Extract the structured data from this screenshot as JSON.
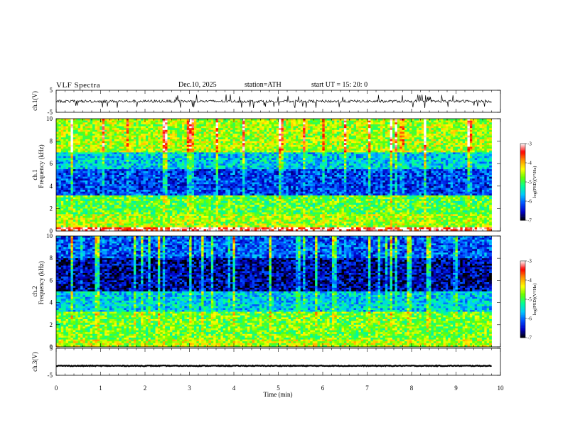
{
  "header": {
    "title": "VLF  Spectra",
    "date": "Dec.10, 2025",
    "station": "station=ATH",
    "start_ut": "start  UT  =    15: 20: 0"
  },
  "chart_data": [
    {
      "type": "line",
      "panel": "ch1-waveform",
      "ylabel": "ch.1(V)",
      "ylim": [
        -5,
        5
      ],
      "y_ticks": [
        "5",
        "-5"
      ],
      "x_range": [
        0,
        9.8
      ],
      "description_values": {
        "baseline": 0,
        "noise_amplitude": 0.6,
        "spike_amplitude": 2.5
      }
    },
    {
      "type": "heatmap",
      "panel": "ch1-spectrogram",
      "ylabel": "ch.1\nFrequency  (kHz)",
      "ylim": [
        0,
        10
      ],
      "y_ticks": [
        "0",
        "2",
        "4",
        "6",
        "8",
        "10"
      ],
      "x_range": [
        0,
        9.8
      ],
      "colorbar": {
        "label": "log(PSD)(V²/Hz)",
        "min": -7,
        "max": -3,
        "ticks": [
          "-3",
          "-4",
          "-5",
          "-6",
          "-7"
        ]
      },
      "bands": [
        {
          "from_khz": 0,
          "to_khz": 0.4,
          "level": -3.2
        },
        {
          "from_khz": 0.4,
          "to_khz": 1.5,
          "level": -4.6
        },
        {
          "from_khz": 1.5,
          "to_khz": 3.2,
          "level": -4.9
        },
        {
          "from_khz": 3.2,
          "to_khz": 5.5,
          "level": -6.2
        },
        {
          "from_khz": 5.5,
          "to_khz": 7.0,
          "level": -5.6
        },
        {
          "from_khz": 7.0,
          "to_khz": 10.0,
          "level": -4.6
        }
      ]
    },
    {
      "type": "heatmap",
      "panel": "ch2-spectrogram",
      "ylabel": "ch.2\nFrequency  (kHz)",
      "ylim": [
        0,
        10
      ],
      "y_ticks": [
        "0",
        "2",
        "4",
        "6",
        "8",
        "10"
      ],
      "x_range": [
        0,
        9.8
      ],
      "colorbar": {
        "label": "log(PSD)(V²/Hz)",
        "min": -7,
        "max": -3,
        "ticks": [
          "-3",
          "-4",
          "-5",
          "-6",
          "-7"
        ]
      },
      "bands": [
        {
          "from_khz": 0,
          "to_khz": 0.6,
          "level": -4.5
        },
        {
          "from_khz": 0.6,
          "to_khz": 3.2,
          "level": -4.8
        },
        {
          "from_khz": 3.2,
          "to_khz": 5.0,
          "level": -5.6
        },
        {
          "from_khz": 5.0,
          "to_khz": 8.0,
          "level": -6.6
        },
        {
          "from_khz": 8.0,
          "to_khz": 10.0,
          "level": -6.1
        }
      ]
    },
    {
      "type": "line",
      "panel": "ch3-waveform",
      "ylabel": "ch.3(V)",
      "ylim": [
        -5,
        5
      ],
      "y_ticks": [
        "5",
        "-5"
      ],
      "x_range": [
        0,
        9.8
      ],
      "description_values": {
        "baseline": -1.5,
        "noise_amplitude": 0.15
      }
    }
  ],
  "x_axis": {
    "label": "Time  (min)",
    "xlim": [
      0,
      10
    ],
    "ticks": [
      "0",
      "1",
      "2",
      "3",
      "4",
      "5",
      "6",
      "7",
      "8",
      "9",
      "10"
    ]
  },
  "colors": {
    "background": "#ffffff",
    "trace": "#000000",
    "colormap": [
      "#000000",
      "#0000c8",
      "#0050ff",
      "#00c8ff",
      "#00ff96",
      "#64ff00",
      "#ffff00",
      "#ff9600",
      "#ff0000",
      "#ffffff"
    ]
  }
}
